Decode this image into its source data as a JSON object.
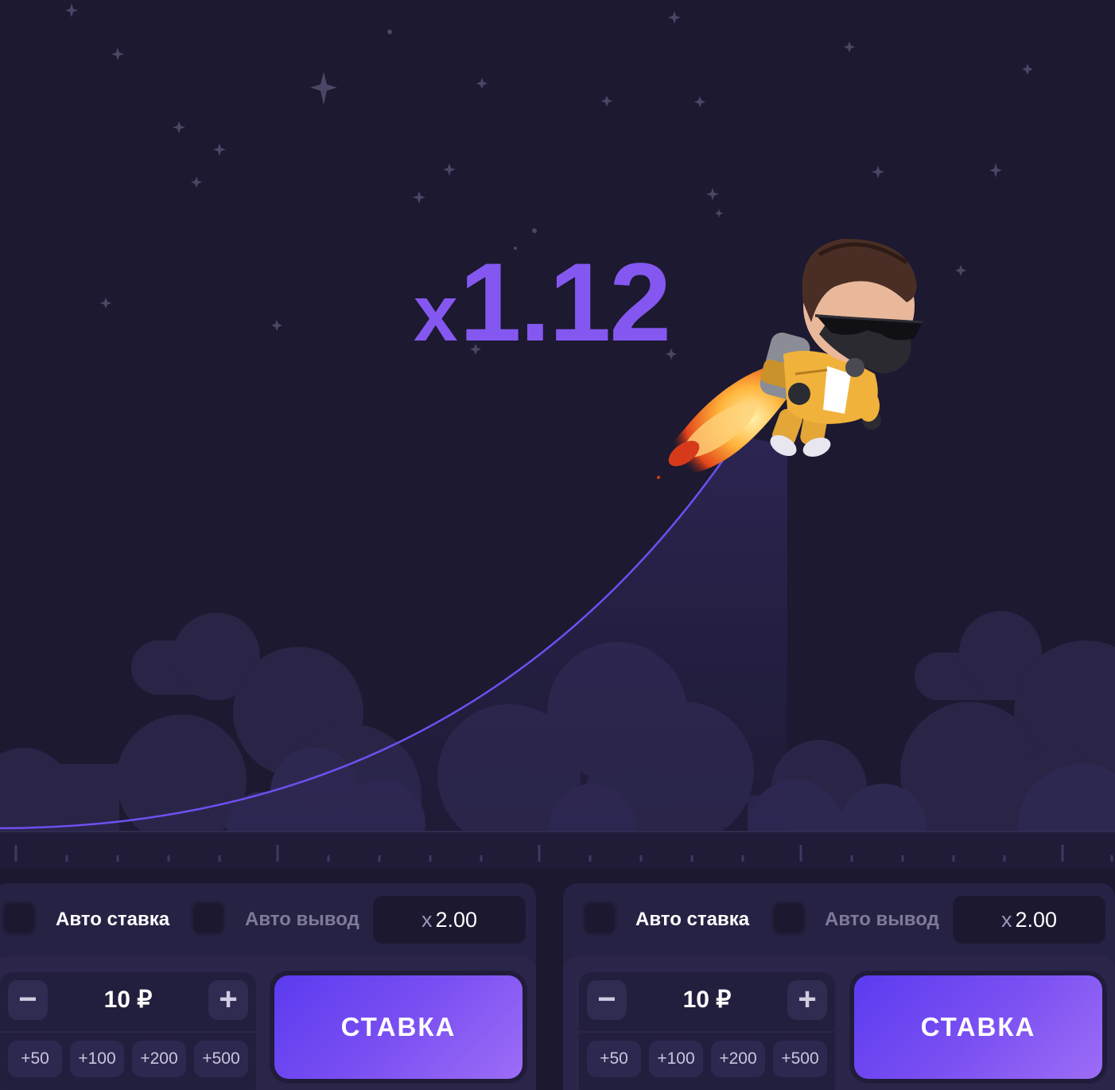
{
  "game": {
    "multiplier_prefix": "x",
    "multiplier_value": "1.12",
    "colors": {
      "accent": "#8458f0",
      "curve": "#6f4ff0",
      "background": "#1c1930",
      "clouds": "#2a2547"
    },
    "character": "jetpack-pilot-figure",
    "trail": "rocket-flame-trail"
  },
  "panels": [
    {
      "auto_bet_label": "Авто ставка",
      "auto_cashout_label": "Авто вывод",
      "cashout_prefix": "x",
      "cashout_value": "2.00",
      "minus_label": "−",
      "plus_label": "+",
      "amount": "10 ₽",
      "quick": [
        "+50",
        "+100",
        "+200",
        "+500"
      ],
      "bet_label": "СТАВКА"
    },
    {
      "auto_bet_label": "Авто ставка",
      "auto_cashout_label": "Авто вывод",
      "cashout_prefix": "x",
      "cashout_value": "2.00",
      "minus_label": "−",
      "plus_label": "+",
      "amount": "10 ₽",
      "quick": [
        "+50",
        "+100",
        "+200",
        "+500"
      ],
      "bet_label": "СТАВКА"
    }
  ]
}
